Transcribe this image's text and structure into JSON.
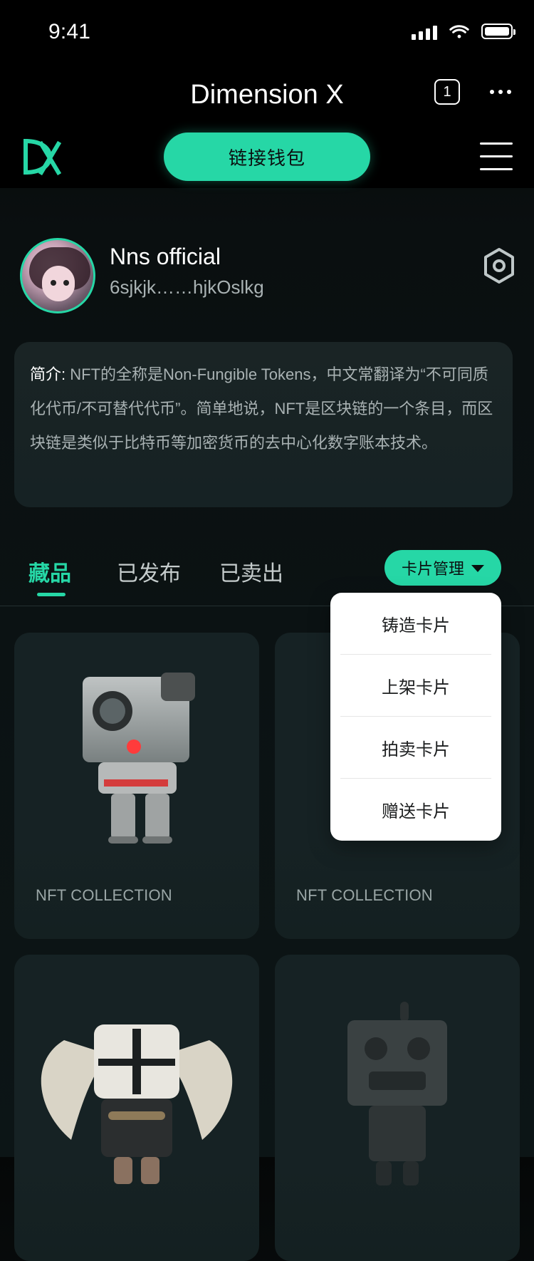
{
  "status_bar": {
    "time": "9:41"
  },
  "header": {
    "title": "Dimension X",
    "tab_count": "1"
  },
  "top_actions": {
    "wallet_button": "链接钱包"
  },
  "profile": {
    "name": "Nns official",
    "address": "6sjkjk……hjkOslkg"
  },
  "intro": {
    "label": "简介:",
    "text": "NFT的全称是Non-Fungible Tokens，中文常翻译为“不可同质化代币/不可替代代币”。简单地说，NFT是区块链的一个条目，而区块链是类似于比特币等加密货币的去中心化数字账本技术。"
  },
  "tabs": [
    {
      "label": "藏品",
      "active": true
    },
    {
      "label": "已发布",
      "active": false
    },
    {
      "label": "已卖出",
      "active": false
    }
  ],
  "card_management": {
    "button_label": "卡片管理",
    "menu": [
      "铸造卡片",
      "上架卡片",
      "拍卖卡片",
      "赠送卡片"
    ]
  },
  "collection": {
    "items": [
      {
        "label": "NFT COLLECTION",
        "art": "camera-robot"
      },
      {
        "label": "NFT COLLECTION",
        "art": "robot"
      },
      {
        "label": "",
        "art": "winged-robot"
      },
      {
        "label": "",
        "art": "classic-robot"
      }
    ]
  },
  "colors": {
    "accent": "#26d7a6",
    "background": "#0b0f10",
    "card": "#162224",
    "muted_text": "#a9b2b3"
  }
}
